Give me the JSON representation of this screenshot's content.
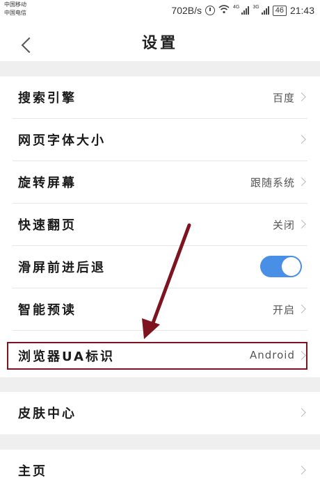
{
  "status_bar": {
    "carrier_1": "中国移动",
    "carrier_2": "中国电信",
    "net_speed": "702B/s",
    "tag_4g": "4G",
    "tag_3g": "3G",
    "battery": "46",
    "time": "21:43"
  },
  "header": {
    "title": "设置"
  },
  "settings": [
    {
      "label": "搜索引擎",
      "value": "百度"
    },
    {
      "label": "网页字体大小",
      "value": ""
    },
    {
      "label": "旋转屏幕",
      "value": "跟随系统"
    },
    {
      "label": "快速翻页",
      "value": "关闭"
    },
    {
      "label": "滑屏前进后退",
      "toggle": "on"
    },
    {
      "label": "智能预读",
      "value": "开启"
    },
    {
      "label": "浏览器UA标识",
      "value": "Android"
    }
  ],
  "section2": [
    {
      "label": "皮肤中心",
      "value": ""
    }
  ],
  "section3": [
    {
      "label": "主页",
      "value": ""
    }
  ],
  "colors": {
    "toggle_on": "#4a8fe6",
    "annotation": "#7d1420",
    "section_gap": "#efefef"
  }
}
